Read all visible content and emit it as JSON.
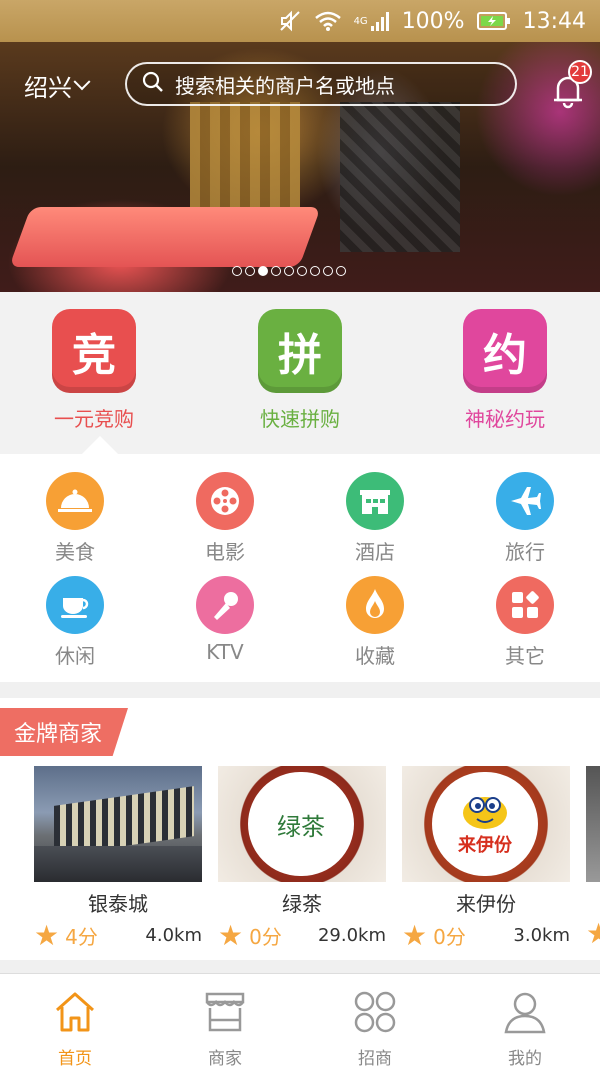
{
  "status_bar": {
    "battery": "100%",
    "time": "13:44",
    "network": "4G"
  },
  "header": {
    "city": "绍兴",
    "search_placeholder": "搜索相关的商户名或地点",
    "notification_count": "21"
  },
  "banner": {
    "dot_count": 9,
    "active_index": 2
  },
  "big_actions": [
    {
      "icon_char": "竞",
      "label": "一元竞购",
      "color": "#e84f4f",
      "label_color": "#e84f4f"
    },
    {
      "icon_char": "拼",
      "label": "快速拼购",
      "color": "#6ab041",
      "label_color": "#6ab041"
    },
    {
      "icon_char": "约",
      "label": "神秘约玩",
      "color": "#e0479d",
      "label_color": "#e0479d"
    }
  ],
  "categories": [
    {
      "label": "美食",
      "icon": "food-cloche-icon",
      "color": "#f7a035"
    },
    {
      "label": "电影",
      "icon": "film-reel-icon",
      "color": "#ef6a60"
    },
    {
      "label": "酒店",
      "icon": "hotel-icon",
      "color": "#3dbc78"
    },
    {
      "label": "旅行",
      "icon": "airplane-icon",
      "color": "#38aee8"
    },
    {
      "label": "休闲",
      "icon": "coffee-cup-icon",
      "color": "#38aee8"
    },
    {
      "label": "KTV",
      "icon": "microphone-icon",
      "color": "#ed6e9f"
    },
    {
      "label": "收藏",
      "icon": "collect-icon",
      "color": "#f7a035"
    },
    {
      "label": "其它",
      "icon": "other-grid-icon",
      "color": "#ef6a60"
    }
  ],
  "gold_section": {
    "title": "金牌商家"
  },
  "merchants": [
    {
      "name": "银泰城",
      "score": "4分",
      "distance": "4.0km"
    },
    {
      "name": "绿茶",
      "score": "0分",
      "distance": "29.0km",
      "logo_text": "绿茶"
    },
    {
      "name": "来伊份",
      "score": "0分",
      "distance": "3.0km",
      "logo_text": "来伊份"
    }
  ],
  "tabbar": [
    {
      "label": "首页",
      "active": true
    },
    {
      "label": "商家",
      "active": false
    },
    {
      "label": "招商",
      "active": false
    },
    {
      "label": "我的",
      "active": false
    }
  ],
  "colors": {
    "accent": "#f29418",
    "inactive": "#888888"
  }
}
